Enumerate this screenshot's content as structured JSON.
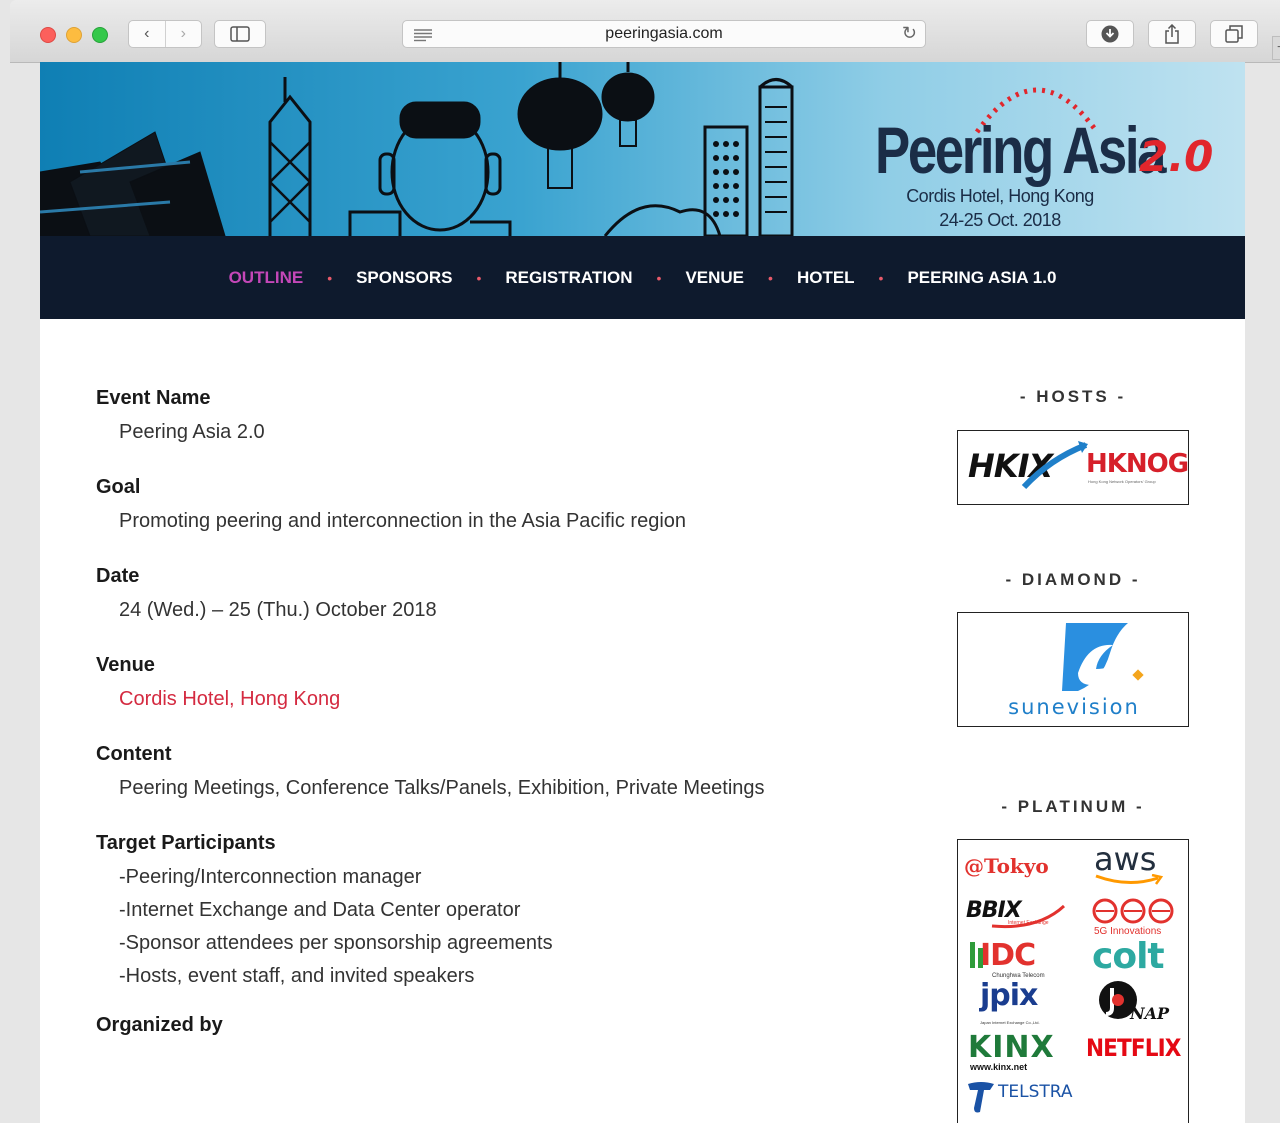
{
  "browser": {
    "url": "peeringasia.com"
  },
  "banner": {
    "title": "Peering Asia",
    "version": "2.0",
    "venue_line": "Cordis Hotel, Hong Kong",
    "date_line": "24-25 Oct. 2018"
  },
  "nav": {
    "items": [
      {
        "label": "OUTLINE",
        "active": true
      },
      {
        "label": "SPONSORS",
        "active": false
      },
      {
        "label": "REGISTRATION",
        "active": false
      },
      {
        "label": "VENUE",
        "active": false
      },
      {
        "label": "HOTEL",
        "active": false
      },
      {
        "label": "PEERING ASIA 1.0",
        "active": false
      }
    ],
    "separator": "•"
  },
  "outline": {
    "event_name_label": "Event Name",
    "event_name": "Peering Asia 2.0",
    "goal_label": "Goal",
    "goal": "Promoting peering and interconnection in the Asia Pacific region",
    "date_label": "Date",
    "date": "24 (Wed.) – 25 (Thu.) October 2018",
    "venue_label": "Venue",
    "venue": "Cordis Hotel, Hong Kong",
    "content_label": "Content",
    "content": "Peering Meetings, Conference Talks/Panels, Exhibition, Private Meetings",
    "participants_label": "Target Participants",
    "participants": [
      "-Peering/Interconnection manager",
      "-Internet Exchange and Data Center operator",
      "-Sponsor attendees per sponsorship agreements",
      "-Hosts, event staff, and invited speakers"
    ],
    "organized_label": "Organized by"
  },
  "sponsors": {
    "hosts_title": "- HOSTS -",
    "hosts": [
      "HKIX",
      "HKNOG"
    ],
    "hknog_sub": "Hong Kong Network Operators' Group",
    "diamond_title": "- DIAMOND -",
    "diamond": [
      "sunevision"
    ],
    "platinum_title": "- PLATINUM -",
    "platinum": [
      {
        "name": "@Tokyo",
        "color": "#e2322e"
      },
      {
        "name": "aws",
        "color": "#232f3e"
      },
      {
        "name": "BBIX",
        "color": "#111111"
      },
      {
        "name": "5G Innovations",
        "color": "#e2322e"
      },
      {
        "name": "IDC",
        "color": "#e2322e"
      },
      {
        "name": "colt",
        "color": "#2da9a1"
      },
      {
        "name": "jpix",
        "color": "#1a3d8f"
      },
      {
        "name": "NAP",
        "color": "#111111"
      },
      {
        "name": "KINX",
        "color": "#1f7a3a"
      },
      {
        "name": "NETFLIX",
        "color": "#e50914"
      },
      {
        "name": "TELSTRA",
        "color": "#1a52a5"
      }
    ],
    "bbix_sub": "Internet Exchange",
    "idc_sub": "Chunghwa Telecom",
    "jpix_sub": "Japan Internet Exchange Co.,Ltd.",
    "kinx_sub": "www.kinx.net"
  }
}
